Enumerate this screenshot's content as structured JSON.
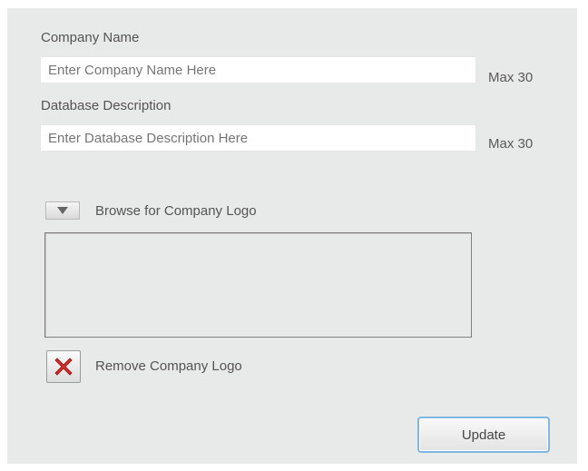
{
  "company_name": {
    "label": "Company Name",
    "placeholder": "Enter Company Name Here",
    "max_note": "Max 30"
  },
  "database_description": {
    "label": "Database Description",
    "placeholder": "Enter Database Description Here",
    "max_note": "Max 30"
  },
  "logo": {
    "browse_label": "Browse for Company Logo",
    "remove_label": "Remove Company Logo"
  },
  "actions": {
    "update_label": "Update"
  },
  "colors": {
    "panel_background": "#e8e9e9",
    "remove_icon_red": "#d82b2b",
    "update_focus_border": "#7fb6e2"
  },
  "icons": {
    "dropdown": "triangle-down-icon",
    "remove": "red-x-icon"
  }
}
